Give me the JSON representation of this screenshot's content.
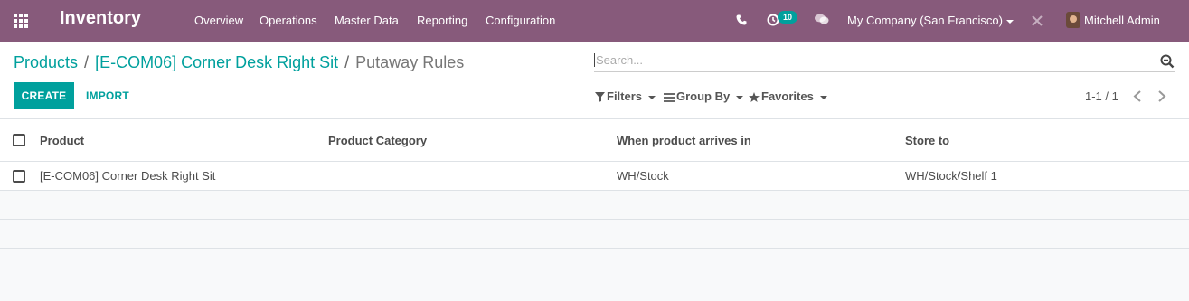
{
  "navbar": {
    "app_name": "Inventory",
    "menu": [
      "Overview",
      "Operations",
      "Master Data",
      "Reporting",
      "Configuration"
    ],
    "activity_count": "10",
    "company": "My Company (San Francisco)",
    "user": "Mitchell Admin",
    "brand_color": "#875a7b"
  },
  "breadcrumb": {
    "items": [
      "Products",
      "[E-COM06] Corner Desk Right Sit"
    ],
    "separator": "/",
    "current": "Putaway Rules"
  },
  "search": {
    "placeholder": "Search..."
  },
  "buttons": {
    "create": "CREATE",
    "import": "IMPORT"
  },
  "filters": {
    "filters": "Filters",
    "group_by": "Group By",
    "favorites": "Favorites"
  },
  "pager": {
    "text": "1-1 / 1"
  },
  "table": {
    "columns": [
      "Product",
      "Product Category",
      "When product arrives in",
      "Store to"
    ],
    "rows": [
      {
        "product": "[E-COM06] Corner Desk Right Sit",
        "category": "",
        "arrives_in": "WH/Stock",
        "store_to": "WH/Stock/Shelf 1"
      }
    ]
  },
  "accent_color": "#00a09d"
}
